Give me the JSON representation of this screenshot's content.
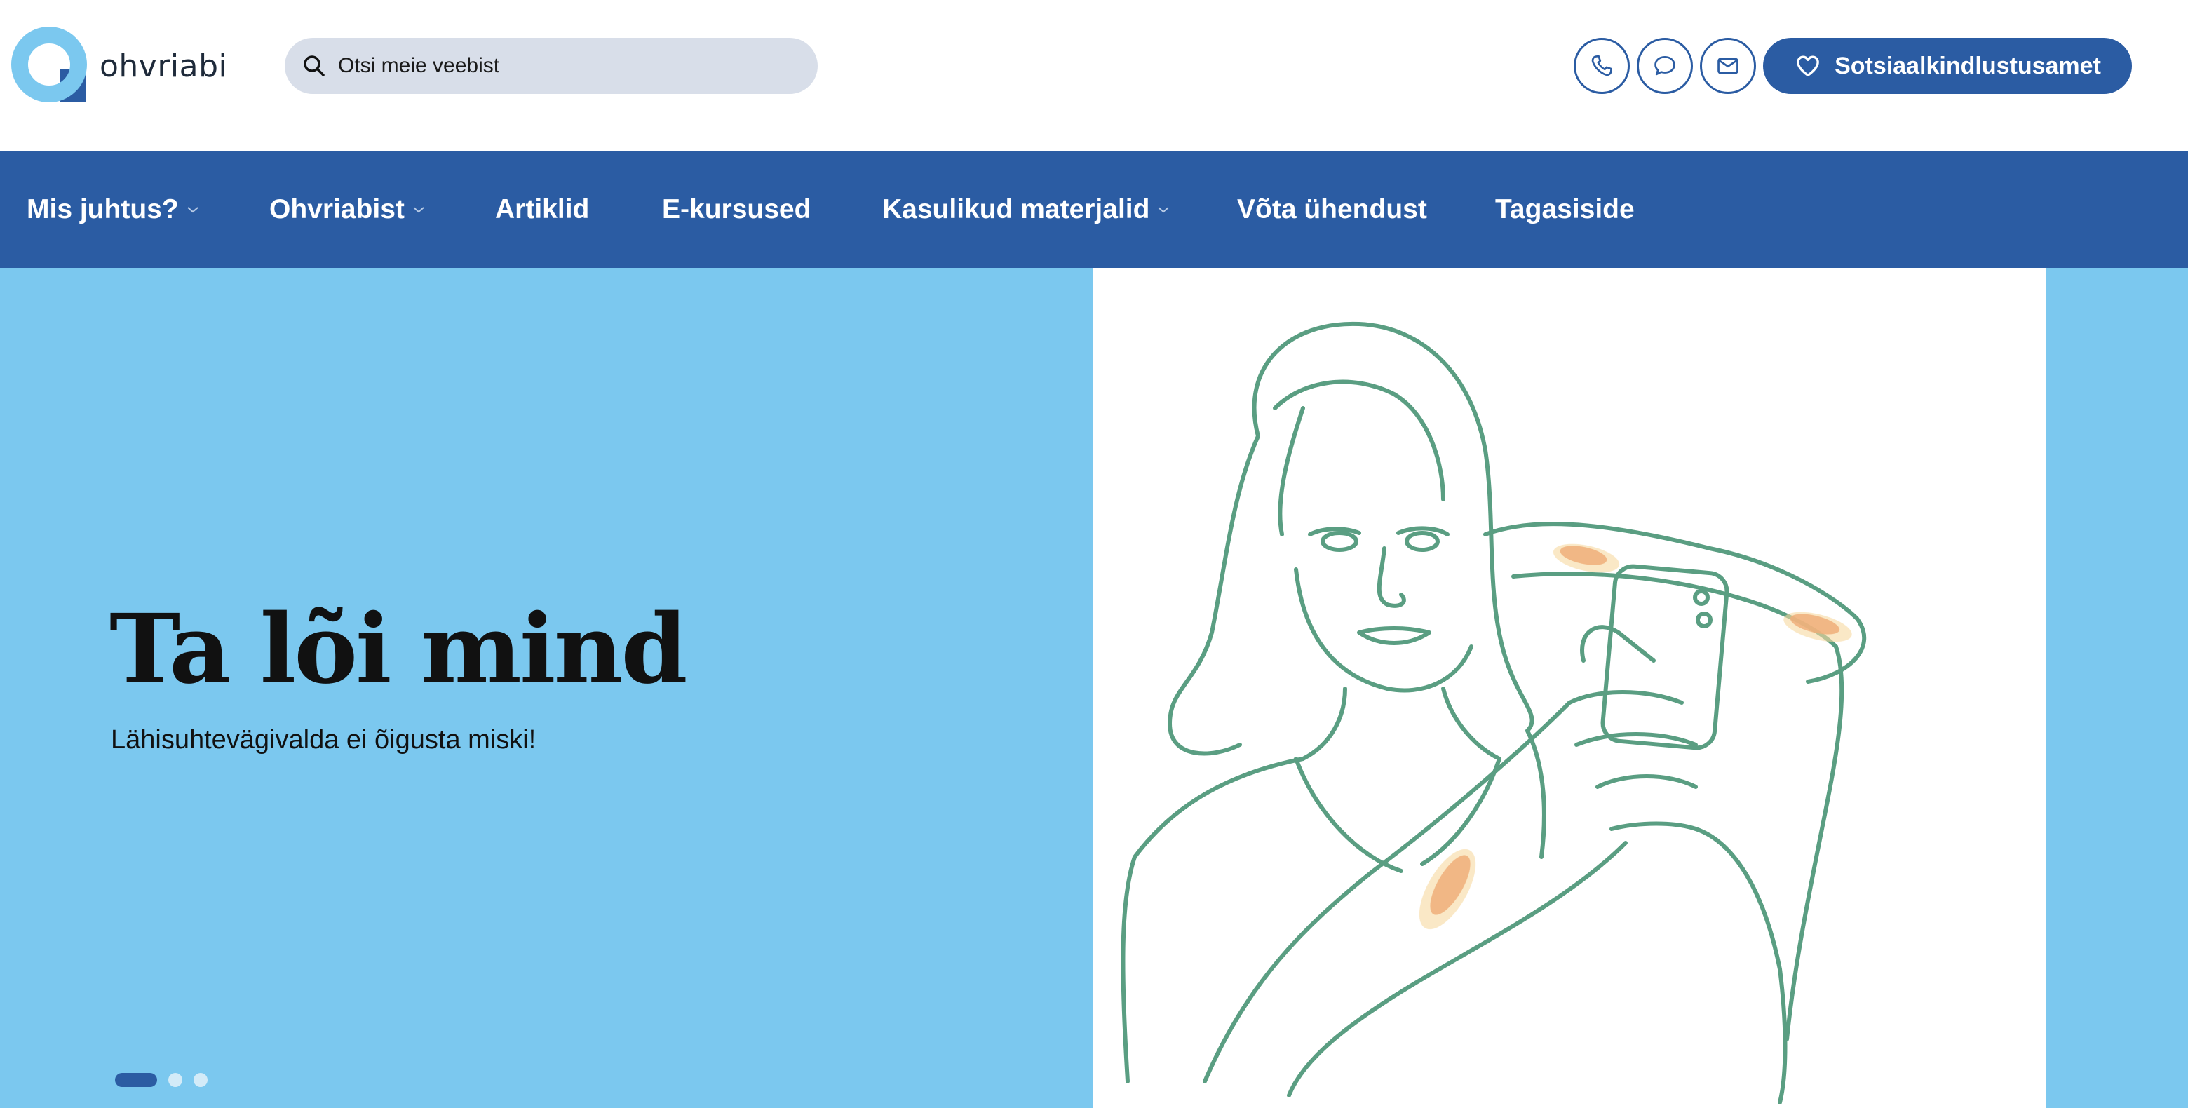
{
  "brand": {
    "name": "ohvriabi"
  },
  "search": {
    "placeholder": "Otsi meie veebist"
  },
  "contact": {
    "icons": [
      "phone-icon",
      "chat-icon",
      "mail-icon"
    ]
  },
  "cta": {
    "label": "Sotsiaalkindlustusamet",
    "icon": "heart-icon"
  },
  "nav": {
    "items": [
      {
        "label": "Mis juhtus?",
        "dropdown": true
      },
      {
        "label": "Ohvriabist",
        "dropdown": true
      },
      {
        "label": "Artiklid",
        "dropdown": false
      },
      {
        "label": "E-kursused",
        "dropdown": false
      },
      {
        "label": "Kasulikud materjalid",
        "dropdown": true
      },
      {
        "label": "Võta ühendust",
        "dropdown": false
      },
      {
        "label": "Tagasiside",
        "dropdown": false
      }
    ]
  },
  "hero": {
    "title": "Ta lõi mind",
    "subtitle": "Lähisuhtevägivalda ei õigusta miski!",
    "slides_total": 3,
    "active_slide": 1
  },
  "colors": {
    "primary": "#2b5ca3",
    "hero_bg": "#7bc8ef",
    "search_bg": "#d8dee9",
    "illustration_line": "#5a9e82",
    "bruise": "#e4713f"
  }
}
